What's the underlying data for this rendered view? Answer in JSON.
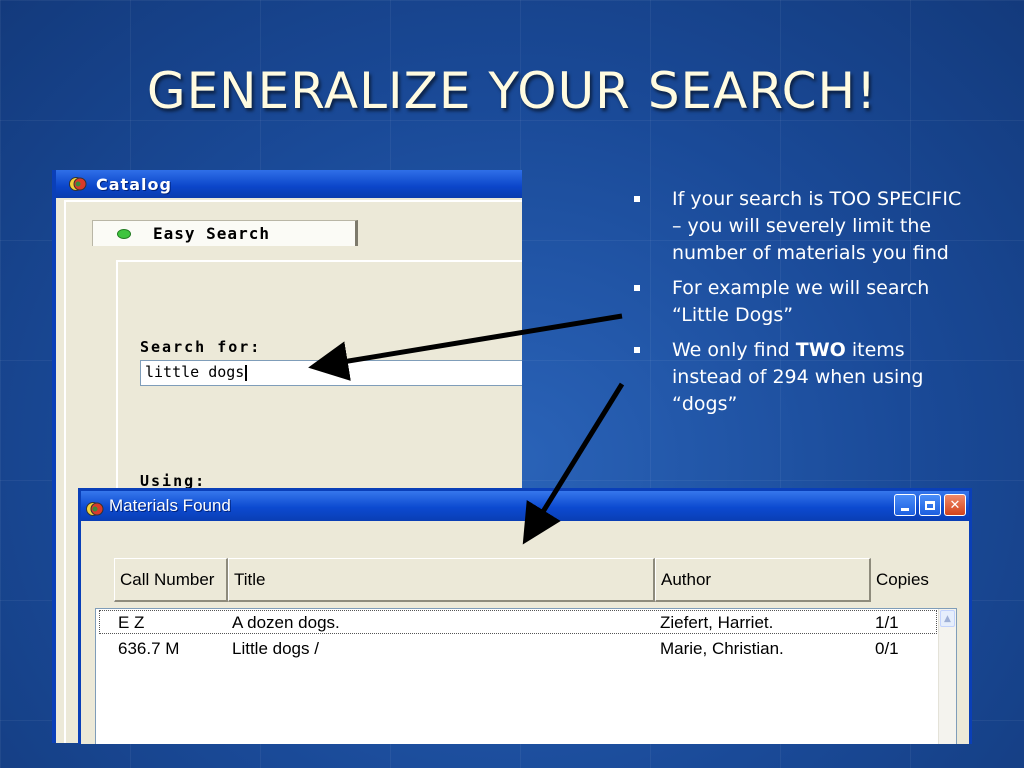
{
  "slide": {
    "title": "GENERALIZE YOUR SEARCH!",
    "bullets": [
      {
        "text": "If your search is TOO SPECIFIC – you will severely limit the number of materials you find"
      },
      {
        "text": "For example we will search “Little Dogs”"
      },
      {
        "pre": "We only find ",
        "bold": "TWO",
        "post": " items instead of 294 when using “dogs”"
      }
    ]
  },
  "catalog_window": {
    "title": "Catalog",
    "tab_label": "Easy Search",
    "search_label": "Search for:",
    "search_value": "little dogs",
    "using_label": "Using:"
  },
  "materials_window": {
    "title": "Materials Found",
    "columns": [
      "Call Number",
      "Title",
      "Author",
      "Copies"
    ],
    "rows": [
      {
        "call_number": "E Z",
        "title": "A dozen dogs.",
        "author": "Ziefert, Harriet.",
        "copies": "1/1"
      },
      {
        "call_number": "636.7 M",
        "title": "Little dogs /",
        "author": "Marie, Christian.",
        "copies": "0/1"
      }
    ]
  },
  "colors": {
    "slide_background": "#1a4a98",
    "title_text": "#fffbe0",
    "xp_titlebar": "#0b45c9",
    "window_body": "#ece9d8"
  }
}
